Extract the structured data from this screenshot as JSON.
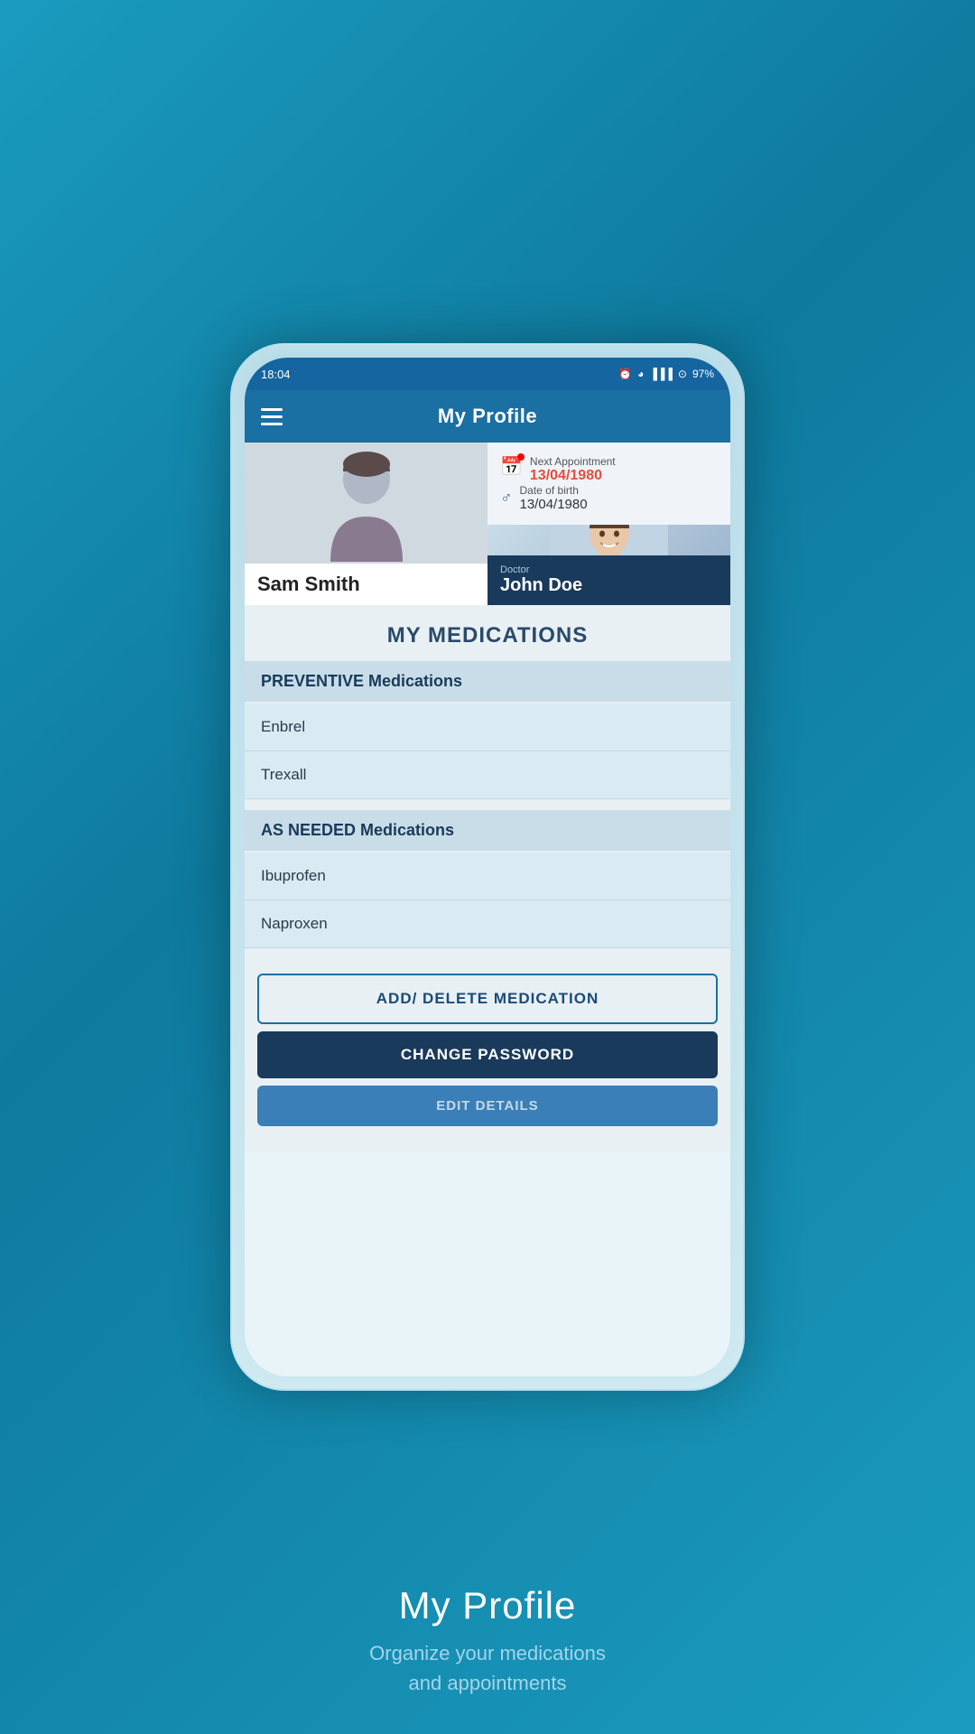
{
  "statusBar": {
    "time": "18:04",
    "battery": "97%"
  },
  "header": {
    "title": "My Profile"
  },
  "patient": {
    "name": "Sam Smith",
    "nextAppointmentLabel": "Next Appointment",
    "nextAppointmentDate": "13/04/1980",
    "dobLabel": "Date of birth",
    "dob": "13/04/1980"
  },
  "doctor": {
    "label": "Doctor",
    "name": "John Doe"
  },
  "medications": {
    "sectionTitle": "MY MEDICATIONS",
    "preventiveLabel": "PREVENTIVE Medications",
    "preventiveMeds": [
      "Enbrel",
      "Trexall"
    ],
    "asNeededLabel": "AS NEEDED Medications",
    "asNeededMeds": [
      "Ibuprofen",
      "Naproxen"
    ]
  },
  "buttons": {
    "addDelete": "ADD/ DELETE MEDICATION",
    "changePassword": "CHANGE PASSWORD",
    "editDetails": "EDIT DETAILS"
  },
  "promo": {
    "title": "My Profile",
    "subtitle": "Organize your medications\nand appointments"
  }
}
